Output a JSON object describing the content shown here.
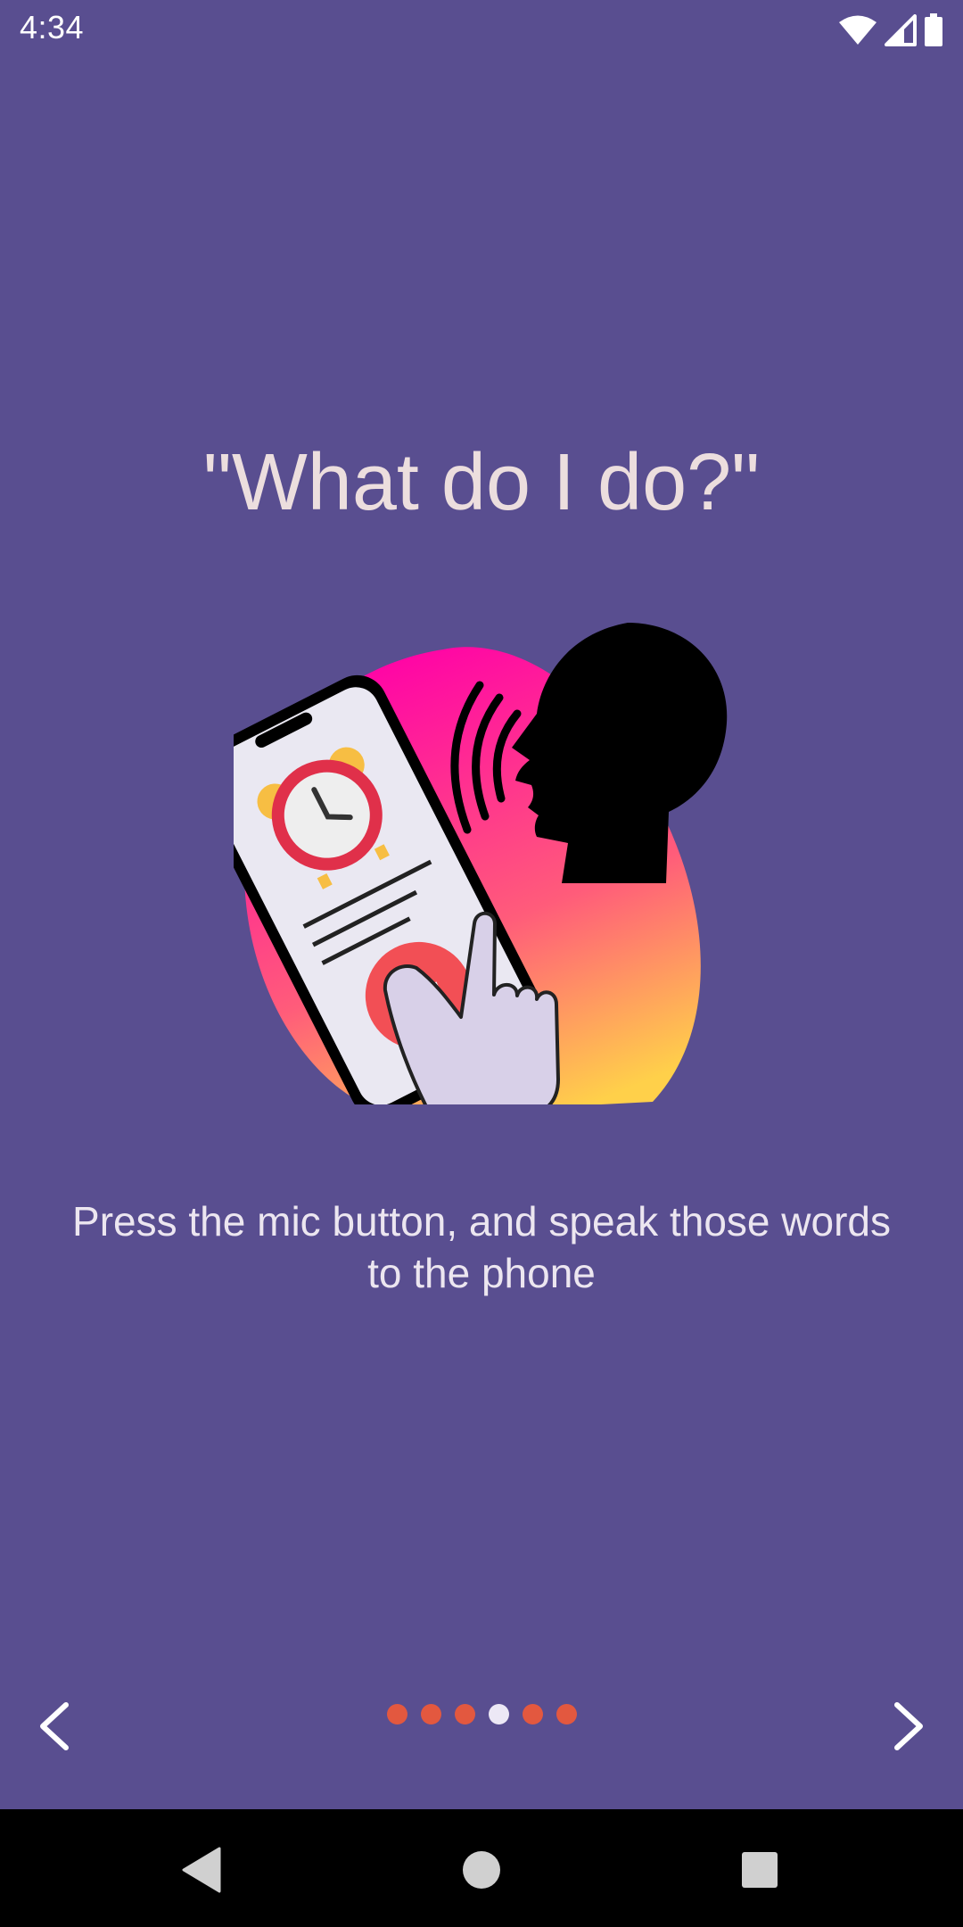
{
  "status_bar": {
    "time": "4:34",
    "icons": [
      "wifi-icon",
      "cellular-signal-icon",
      "battery-icon"
    ]
  },
  "onboarding": {
    "title": "\"What do I do?\"",
    "description": "Press the mic button, and speak those words to the phone",
    "illustration": "person-speaking-to-phone-with-alarm-and-mic",
    "page_count": 6,
    "current_page": 4
  },
  "navigation": {
    "prev_icon": "chevron-left-icon",
    "next_icon": "chevron-right-icon"
  },
  "system_nav": {
    "back_icon": "back-triangle-icon",
    "home_icon": "home-circle-icon",
    "recents_icon": "recents-square-icon"
  },
  "colors": {
    "background": "#594e90",
    "title_text": "#ecdede",
    "dot_inactive": "#e3583f",
    "dot_active": "#ece8f5",
    "mic_button": "#f24f55",
    "alarm_red": "#e0304a"
  }
}
